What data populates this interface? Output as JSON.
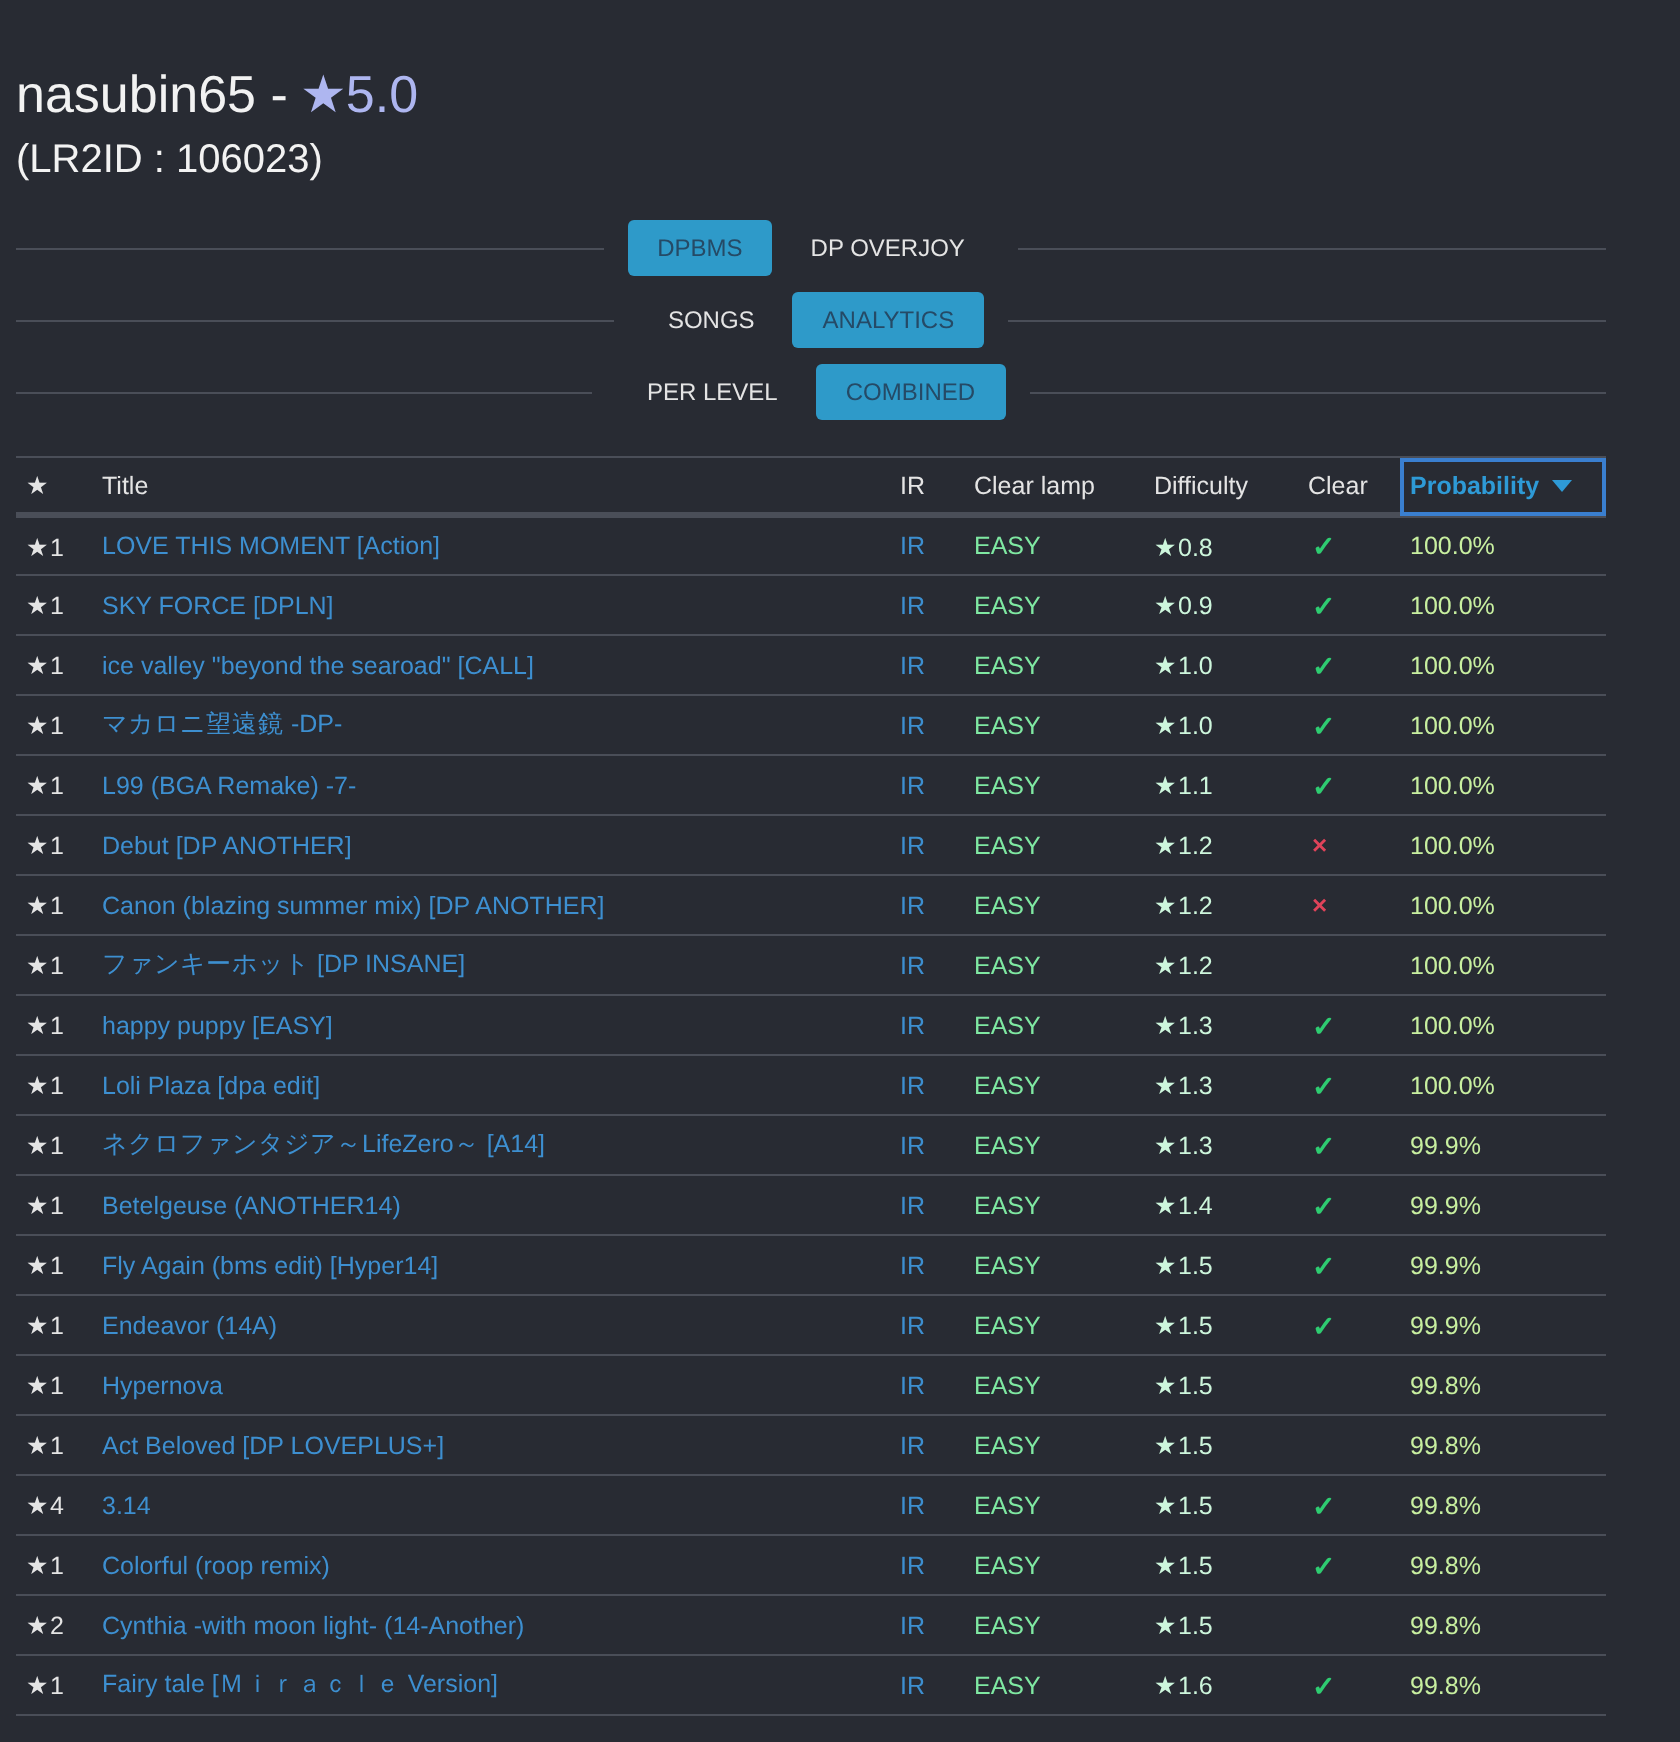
{
  "player": {
    "name": "nasubin65 -",
    "rating": "★5.0",
    "lr2id": "(LR2ID : 106023)"
  },
  "toggle_rows": [
    {
      "options": [
        {
          "label": "DPBMS",
          "selected": true
        },
        {
          "label": "DP OVERJOY",
          "selected": false
        }
      ]
    },
    {
      "options": [
        {
          "label": "SONGS",
          "selected": false
        },
        {
          "label": "ANALYTICS",
          "selected": true
        }
      ]
    },
    {
      "options": [
        {
          "label": "PER LEVEL",
          "selected": false
        },
        {
          "label": "COMBINED",
          "selected": true
        }
      ]
    }
  ],
  "table": {
    "columns": [
      {
        "label": "★",
        "sorted": false
      },
      {
        "label": "Title",
        "sorted": false
      },
      {
        "label": "IR",
        "sorted": false
      },
      {
        "label": "Clear lamp",
        "sorted": false
      },
      {
        "label": "Difficulty",
        "sorted": false
      },
      {
        "label": "Clear",
        "sorted": false
      },
      {
        "label": "Probability",
        "sorted": true
      }
    ],
    "rows": [
      {
        "level": "★1",
        "title": "LOVE THIS MOMENT [Action]",
        "ir": "IR",
        "lamp": "EASY",
        "difficulty": "★0.8",
        "clear": "✓",
        "kind": "check",
        "probability": "100.0%"
      },
      {
        "level": "★1",
        "title": "SKY FORCE [DPLN]",
        "ir": "IR",
        "lamp": "EASY",
        "difficulty": "★0.9",
        "clear": "✓",
        "kind": "check",
        "probability": "100.0%"
      },
      {
        "level": "★1",
        "title": "ice valley \"beyond the searoad\" [CALL]",
        "ir": "IR",
        "lamp": "EASY",
        "difficulty": "★1.0",
        "clear": "✓",
        "kind": "check",
        "probability": "100.0%"
      },
      {
        "level": "★1",
        "title": "マカロニ望遠鏡 -DP-",
        "ir": "IR",
        "lamp": "EASY",
        "difficulty": "★1.0",
        "clear": "✓",
        "kind": "check",
        "probability": "100.0%"
      },
      {
        "level": "★1",
        "title": "L99 (BGA Remake) -7-",
        "ir": "IR",
        "lamp": "EASY",
        "difficulty": "★1.1",
        "clear": "✓",
        "kind": "check",
        "probability": "100.0%"
      },
      {
        "level": "★1",
        "title": "Debut [DP ANOTHER]",
        "ir": "IR",
        "lamp": "EASY",
        "difficulty": "★1.2",
        "clear": "×",
        "kind": "cross",
        "probability": "100.0%"
      },
      {
        "level": "★1",
        "title": "Canon (blazing summer mix) [DP ANOTHER]",
        "ir": "IR",
        "lamp": "EASY",
        "difficulty": "★1.2",
        "clear": "×",
        "kind": "cross",
        "probability": "100.0%"
      },
      {
        "level": "★1",
        "title": "ファンキーホット [DP INSANE]",
        "ir": "IR",
        "lamp": "EASY",
        "difficulty": "★1.2",
        "probability": "100.0%"
      },
      {
        "level": "★1",
        "title": "happy puppy [EASY]",
        "ir": "IR",
        "lamp": "EASY",
        "difficulty": "★1.3",
        "clear": "✓",
        "kind": "check",
        "probability": "100.0%"
      },
      {
        "level": "★1",
        "title": "Loli Plaza [dpa edit]",
        "ir": "IR",
        "lamp": "EASY",
        "difficulty": "★1.3",
        "clear": "✓",
        "kind": "check",
        "probability": "100.0%"
      },
      {
        "level": "★1",
        "title": "ネクロファンタジア～LifeZero～ [A14]",
        "ir": "IR",
        "lamp": "EASY",
        "difficulty": "★1.3",
        "clear": "✓",
        "kind": "check",
        "probability": "99.9%"
      },
      {
        "level": "★1",
        "title": "Betelgeuse (ANOTHER14)",
        "ir": "IR",
        "lamp": "EASY",
        "difficulty": "★1.4",
        "clear": "✓",
        "kind": "check",
        "probability": "99.9%"
      },
      {
        "level": "★1",
        "title": "Fly Again (bms edit) [Hyper14]",
        "ir": "IR",
        "lamp": "EASY",
        "difficulty": "★1.5",
        "clear": "✓",
        "kind": "check",
        "probability": "99.9%"
      },
      {
        "level": "★1",
        "title": "Endeavor (14A)",
        "ir": "IR",
        "lamp": "EASY",
        "difficulty": "★1.5",
        "clear": "✓",
        "kind": "check",
        "probability": "99.9%"
      },
      {
        "level": "★1",
        "title": "Hypernova",
        "ir": "IR",
        "lamp": "EASY",
        "difficulty": "★1.5",
        "probability": "99.8%"
      },
      {
        "level": "★1",
        "title": "Act Beloved [DP LOVEPLUS+]",
        "ir": "IR",
        "lamp": "EASY",
        "difficulty": "★1.5",
        "probability": "99.8%"
      },
      {
        "level": "★4",
        "title": "3.14",
        "ir": "IR",
        "lamp": "EASY",
        "difficulty": "★1.5",
        "clear": "✓",
        "kind": "check",
        "probability": "99.8%"
      },
      {
        "level": "★1",
        "title": "Colorful (roop remix)",
        "ir": "IR",
        "lamp": "EASY",
        "difficulty": "★1.5",
        "clear": "✓",
        "kind": "check",
        "probability": "99.8%"
      },
      {
        "level": "★2",
        "title": "Cynthia -with moon light- (14-Another)",
        "ir": "IR",
        "lamp": "EASY",
        "difficulty": "★1.5",
        "probability": "99.8%"
      },
      {
        "level": "★1",
        "title": "Fairy tale [Ｍｉｒａｃｌｅ Version]",
        "ir": "IR",
        "lamp": "EASY",
        "difficulty": "★1.6",
        "clear": "✓",
        "kind": "check",
        "probability": "99.8%"
      }
    ]
  }
}
